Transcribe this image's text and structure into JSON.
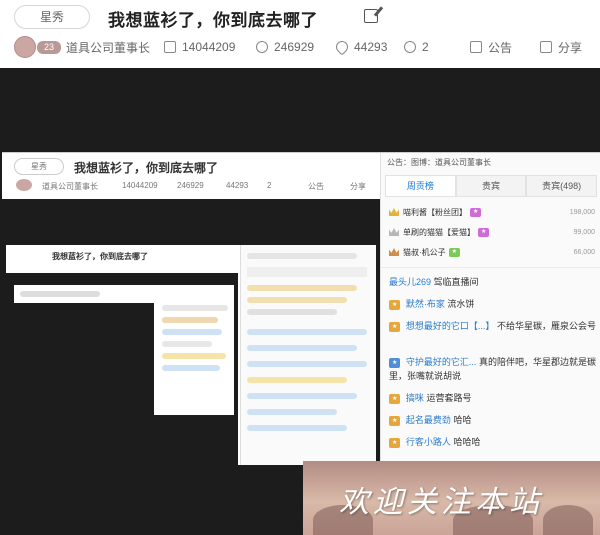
{
  "header": {
    "tag": "星秀",
    "title": "我想蓝衫了，你到底去哪了",
    "level": "23",
    "author": "道具公司董事长",
    "room_id": "14044209",
    "followers": "246929",
    "likes": "44293",
    "shares": "2",
    "notice_label": "公告",
    "share_label": "分享"
  },
  "inner": {
    "tag": "星秀",
    "title": "我想蓝衫了，你到底去哪了",
    "author": "道具公司董事长",
    "room_id": "14044209",
    "followers": "246929",
    "likes": "44293",
    "shares": "2",
    "notice_label": "公告",
    "share_label": "分享",
    "panel_notice": "公告：图博：道具公司董事长",
    "tabs": [
      "周贡榜",
      "贵宾",
      "贵宾(498)"
    ],
    "ranks": [
      {
        "name": "喵利酱【粉丝团】",
        "score": "198,000"
      },
      {
        "name": "单刷的猫猫【爱猫】",
        "score": "99,000"
      },
      {
        "name": "猫叔·机公子",
        "score": "66,000"
      }
    ],
    "chats": [
      {
        "user": "最头儿269",
        "msg": "驾临直播间"
      },
      {
        "user": "默然·布家",
        "msg": "流水饼"
      },
      {
        "user": "想想最好的它口【...】",
        "msg": "不给华星碳，雁泉公会号"
      },
      {
        "user": "守护最好的它汇...",
        "msg": "真的陪伴吧，华星郡边就是碳里，张嘴就说胡说"
      },
      {
        "user": "搞咪",
        "msg": "运营套路号"
      },
      {
        "user": "起名最费劲",
        "msg": "哈哈"
      },
      {
        "user": "行客小路人",
        "msg": "哈哈哈"
      }
    ]
  },
  "nested": {
    "title": "我想蓝衫了，你到底去哪了"
  },
  "banner": {
    "text": "欢迎关注本站"
  },
  "colors": {
    "dark_bg": "#1c1c1d",
    "link_blue": "#2a7bcc",
    "gold": "#e3b33b"
  }
}
